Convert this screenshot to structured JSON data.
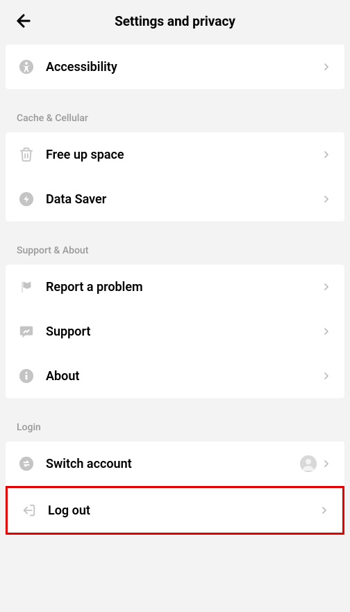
{
  "header": {
    "title": "Settings and privacy"
  },
  "groups": {
    "top": {
      "accessibility": "Accessibility"
    },
    "cache": {
      "label": "Cache & Cellular",
      "free_space": "Free up space",
      "data_saver": "Data Saver"
    },
    "support": {
      "label": "Support & About",
      "report": "Report a problem",
      "support": "Support",
      "about": "About"
    },
    "login": {
      "label": "Login",
      "switch": "Switch account",
      "logout": "Log out"
    }
  }
}
